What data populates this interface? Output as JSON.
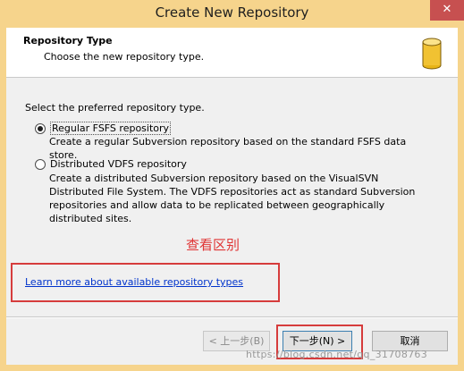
{
  "window": {
    "title": "Create New Repository",
    "close_label": "✕"
  },
  "header": {
    "title": "Repository Type",
    "subtitle": "Choose the new repository type.",
    "icon": "database-icon"
  },
  "content": {
    "prompt": "Select the preferred repository type.",
    "options": [
      {
        "label": "Regular FSFS repository",
        "checked": true,
        "description": "Create a regular Subversion repository based on the standard FSFS data store."
      },
      {
        "label": "Distributed VDFS repository",
        "checked": false,
        "description": "Create a distributed Subversion repository based on the VisualSVN Distributed File System. The VDFS repositories act as standard Subversion repositories and allow data to be replicated between geographically distributed sites."
      }
    ],
    "annotation": "查看区别",
    "learn_more_link": "Learn more about available repository types"
  },
  "footer": {
    "back_label": "< 上一步(B)",
    "next_label": "下一步(N) >",
    "cancel_label": "取消"
  },
  "watermark": "https://blog.csdn.net/qq_31708763",
  "colors": {
    "title_bar": "#f6d48c",
    "close_button": "#c75050",
    "annotation_red": "#d63c3c",
    "link_blue": "#0033cc"
  }
}
